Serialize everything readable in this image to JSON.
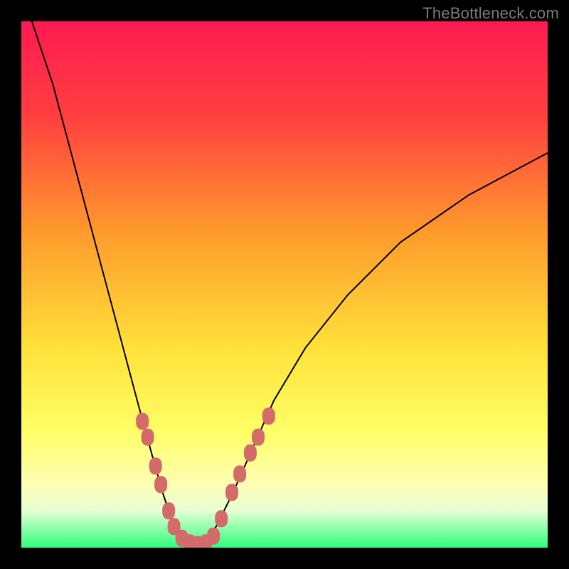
{
  "watermark": {
    "text": "TheBottleneck.com"
  },
  "colors": {
    "frame": "#000000",
    "gradient_stops": [
      {
        "pct": 0,
        "color": "#ff1a53"
      },
      {
        "pct": 18,
        "color": "#ff3f3f"
      },
      {
        "pct": 40,
        "color": "#ff9a2c"
      },
      {
        "pct": 62,
        "color": "#ffe13a"
      },
      {
        "pct": 78,
        "color": "#ffff66"
      },
      {
        "pct": 88,
        "color": "#ffffb3"
      },
      {
        "pct": 93,
        "color": "#e6ffd4"
      },
      {
        "pct": 100,
        "color": "#2dff7a"
      }
    ],
    "curve_black": "#000000",
    "beads": "#d46a6a"
  },
  "chart_data": {
    "type": "line",
    "title": "",
    "xlabel": "",
    "ylabel": "",
    "xlim": [
      0,
      100
    ],
    "ylim": [
      0,
      100
    ],
    "series": [
      {
        "name": "bottleneck-curve",
        "x": [
          2,
          6,
          10,
          14,
          18,
          22,
          25,
          27,
          29,
          31,
          33,
          35,
          37,
          40,
          44,
          48,
          54,
          62,
          72,
          85,
          100
        ],
        "y": [
          100,
          88,
          73,
          58,
          43,
          28,
          17,
          10,
          4,
          1,
          0,
          1,
          4,
          10,
          19,
          28,
          38,
          48,
          58,
          67,
          75
        ]
      }
    ],
    "beads": [
      {
        "x": 23.0,
        "y": 24.0
      },
      {
        "x": 24.0,
        "y": 21.0
      },
      {
        "x": 25.5,
        "y": 15.5
      },
      {
        "x": 26.5,
        "y": 12.0
      },
      {
        "x": 28.0,
        "y": 7.0
      },
      {
        "x": 29.0,
        "y": 4.0
      },
      {
        "x": 30.5,
        "y": 1.8
      },
      {
        "x": 32.0,
        "y": 0.9
      },
      {
        "x": 33.5,
        "y": 0.6
      },
      {
        "x": 35.0,
        "y": 0.9
      },
      {
        "x": 36.5,
        "y": 2.2
      },
      {
        "x": 38.0,
        "y": 5.5
      },
      {
        "x": 40.0,
        "y": 10.5
      },
      {
        "x": 41.5,
        "y": 14.0
      },
      {
        "x": 43.5,
        "y": 18.0
      },
      {
        "x": 45.0,
        "y": 21.0
      },
      {
        "x": 47.0,
        "y": 25.0
      }
    ],
    "grid": false,
    "legend": false
  }
}
